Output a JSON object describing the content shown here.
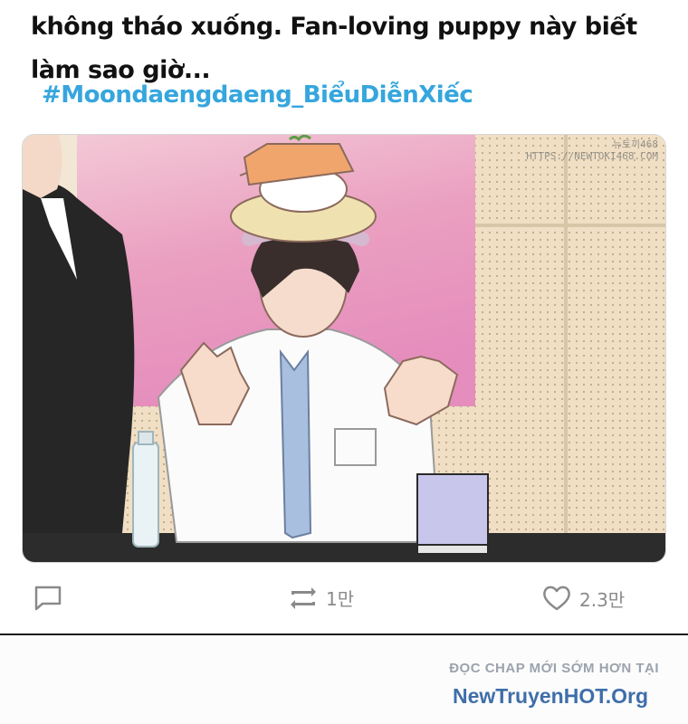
{
  "post": {
    "text": "không tháo xuống. Fan-loving puppy này biết làm sao giờ...",
    "hashtag": "#Moondaengdaeng_BiểuDiễnXiếc"
  },
  "media": {
    "watermark_line1": "뉴토끼468",
    "watermark_line2": "HTTPS://NEWTOKI468.COM"
  },
  "actions": {
    "reply_icon": "comment-icon",
    "retweet_icon": "retweet-icon",
    "retweet_count": "1만",
    "like_icon": "heart-icon",
    "like_count": "2.3만"
  },
  "footer": {
    "tagline": "ĐỌC CHAP MỚI SỚM HƠN TẠI",
    "site": "NewTruyenHOT.Org"
  },
  "colors": {
    "hashtag": "#36a6dd",
    "footer_site": "#3f6ea9",
    "icon_gray": "#8a8a8a"
  }
}
